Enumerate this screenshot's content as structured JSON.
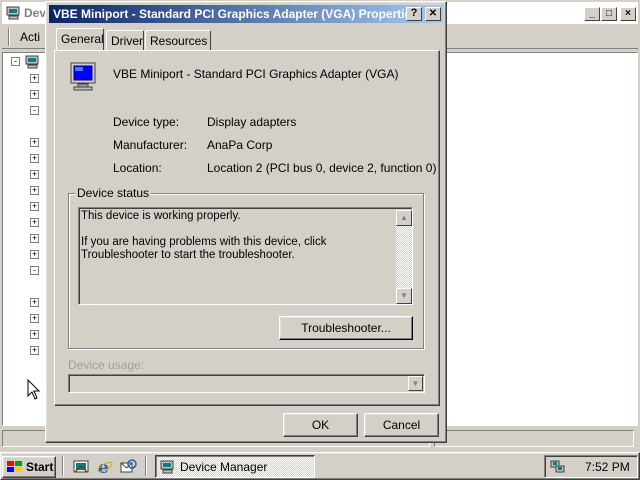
{
  "background_window": {
    "title": "Dev",
    "toolbar_action": "Acti",
    "tree_expanders": [
      "-",
      "+",
      "+",
      "-",
      "+",
      "+",
      "+",
      "+",
      "+",
      "+",
      "+",
      "+",
      "-",
      "+",
      "+",
      "+",
      "+"
    ]
  },
  "dialog": {
    "title": "VBE Miniport - Standard PCI Graphics Adapter (VGA) Properties",
    "help_button": "?",
    "close_button": "✕",
    "tabs": [
      "General",
      "Driver",
      "Resources"
    ],
    "active_tab": "General",
    "device_name": "VBE Miniport - Standard PCI Graphics Adapter (VGA)",
    "fields": [
      {
        "label": "Device type:",
        "value": "Display adapters"
      },
      {
        "label": "Manufacturer:",
        "value": "AnaPa Corp"
      },
      {
        "label": "Location:",
        "value": "Location 2 (PCI bus 0, device 2, function 0)"
      }
    ],
    "device_status_label": "Device status",
    "status_line1": "This device is working properly.",
    "status_line2": "If you are having problems with this device, click Troubleshooter to start the troubleshooter.",
    "troubleshooter_button": "Troubleshooter...",
    "device_usage_label": "Device usage:",
    "device_usage_value": "",
    "ok_button": "OK",
    "cancel_button": "Cancel"
  },
  "taskbar": {
    "start_label": "Start",
    "quicklaunch_icons": [
      "show-desktop-icon",
      "internet-explorer-icon",
      "outlook-express-icon"
    ],
    "task_label": "Device Manager",
    "clock": "7:52 PM",
    "tray_icons": [
      "network-icon"
    ]
  },
  "colors": {
    "face": "#d4d0c8",
    "title_active": "#0a246a",
    "title_gradient_end": "#a6caf0",
    "desktop_text_disabled": "#808080"
  }
}
